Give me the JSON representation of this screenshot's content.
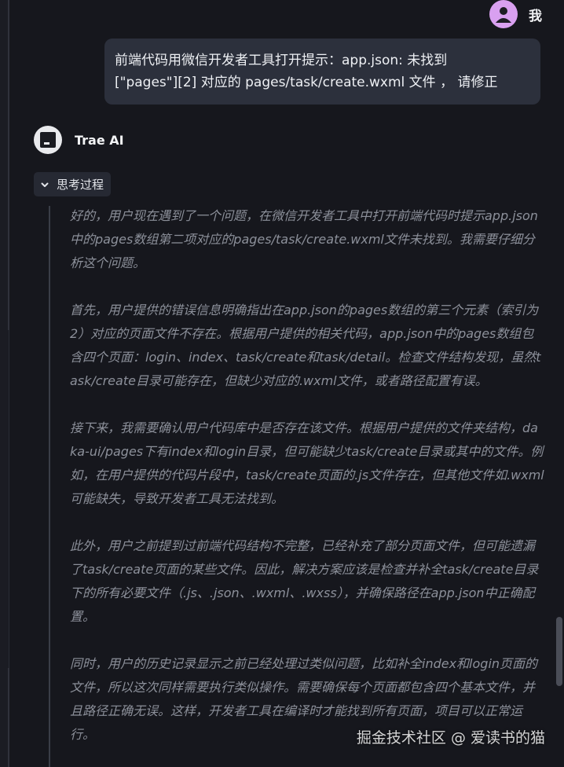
{
  "user": {
    "name": "我",
    "message_line1": "前端代码用微信开发者工具打开提示：app.json: 未找到",
    "message_line2": "[\"pages\"][2] 对应的 pages/task/create.wxml 文件 ， 请修正"
  },
  "assistant": {
    "name": "Trae AI",
    "thinking_label": "思考过程",
    "paragraphs": [
      "好的，用户现在遇到了一个问题，在微信开发者工具中打开前端代码时提示app.json中的pages数组第二项对应的pages/task/create.wxml文件未找到。我需要仔细分析这个问题。",
      "首先，用户提供的错误信息明确指出在app.json的pages数组的第三个元素（索引为2）对应的页面文件不存在。根据用户提供的相关代码，app.json中的pages数组包含四个页面：login、index、task/create和task/detail。检查文件结构发现，虽然task/create目录可能存在，但缺少对应的.wxml文件，或者路径配置有误。",
      "接下来，我需要确认用户代码库中是否存在该文件。根据用户提供的文件夹结构，daka-ui/pages下有index和login目录，但可能缺少task/create目录或其中的文件。例如，在用户提供的代码片段中，task/create页面的.js文件存在，但其他文件如.wxml可能缺失，导致开发者工具无法找到。",
      "此外，用户之前提到过前端代码结构不完整，已经补充了部分页面文件，但可能遗漏了task/create页面的某些文件。因此，解决方案应该是检查并补全task/create目录下的所有必要文件（.js、.json、.wxml、.wxss），并确保路径在app.json中正确配置。",
      "同时，用户的历史记录显示之前已经处理过类似问题，比如补全index和login页面的文件，所以这次同样需要执行类似操作。需要确保每个页面都包含四个基本文件，并且路径正确无误。这样，开发者工具在编译时才能找到所有页面，项目可以正常运行。"
    ]
  },
  "watermark": "掘金技术社区 @ 爱读书的猫",
  "colors": {
    "background": "#16171d",
    "user_bubble": "#2c303c",
    "avatar": "#d9a0f0",
    "thinking_text": "#8c909a"
  },
  "icons": [
    "user-avatar-icon",
    "trae-logo-icon",
    "chevron-down-icon"
  ]
}
